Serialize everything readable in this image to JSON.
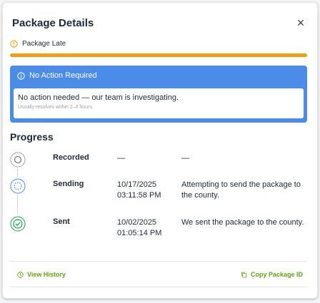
{
  "dialog": {
    "title": "Package Details",
    "close_glyph": "×"
  },
  "status": {
    "label": "Package Late",
    "bar_color": "#f59e0b"
  },
  "alert": {
    "title": "No Action Required",
    "message": "No action needed — our team is investigating.",
    "subtext": "Usually resolves within 2–4 hours.",
    "color": "#4a8ce8"
  },
  "progress": {
    "heading": "Progress",
    "steps": [
      {
        "label": "Recorded",
        "date": "—",
        "time": "",
        "description": "—",
        "state": "recorded",
        "icon": "circle-icon"
      },
      {
        "label": "Sending",
        "date": "10/17/2025",
        "time": "03:11:58 PM",
        "description": "Attempting to send the package to the county.",
        "state": "in-progress",
        "icon": "dotted-circle-icon"
      },
      {
        "label": "Sent",
        "date": "10/02/2025",
        "time": "01:05:14 PM",
        "description": "We sent the package to the county.",
        "state": "complete",
        "icon": "check-circle-icon"
      }
    ]
  },
  "footer": {
    "view_history": "View History",
    "copy_id": "Copy Package ID",
    "link_color": "#65a30d"
  }
}
